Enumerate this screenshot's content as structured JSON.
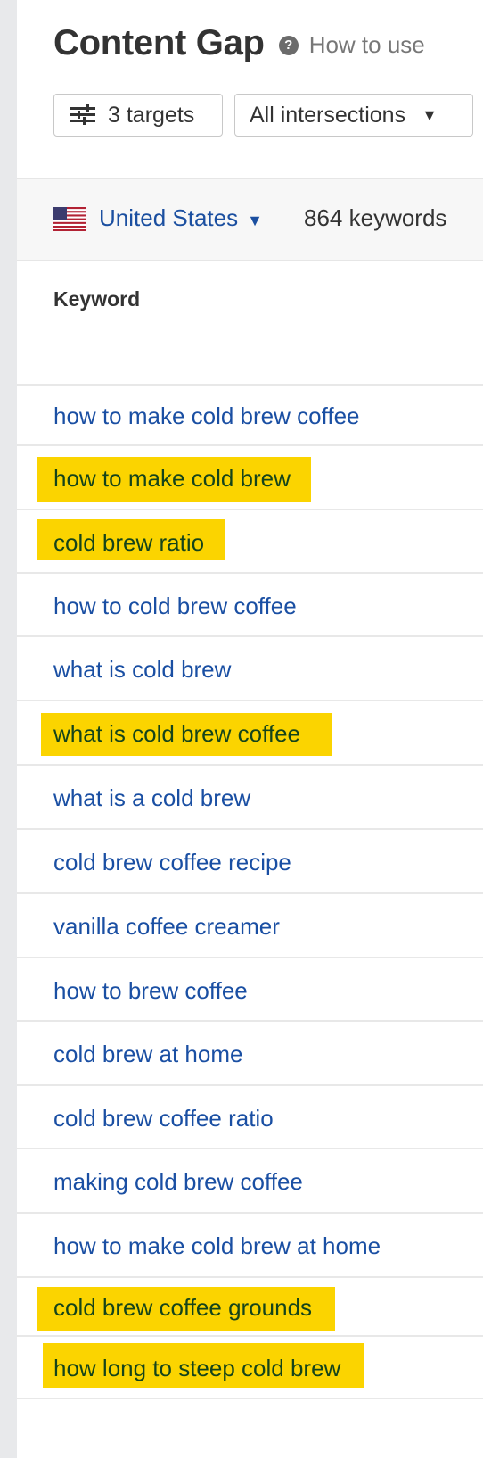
{
  "header": {
    "title": "Content Gap",
    "help_icon": "question-circle-icon",
    "help_label": "How to use"
  },
  "toolbar": {
    "targets_icon": "sliders-icon",
    "targets_label": "3 targets",
    "intersections_label": "All intersections",
    "intersections_caret": "▼"
  },
  "filter": {
    "flag_icon": "us-flag-icon",
    "country": "United States",
    "country_caret": "▼",
    "keyword_count": "864 keywords"
  },
  "table": {
    "column_header": "Keyword",
    "highlight_color": "#fbd400",
    "rows": [
      {
        "keyword": "how to make cold brew coffee",
        "highlighted": false
      },
      {
        "keyword": "how to make cold brew",
        "highlighted": true
      },
      {
        "keyword": "cold brew ratio",
        "highlighted": true
      },
      {
        "keyword": "how to cold brew coffee",
        "highlighted": false
      },
      {
        "keyword": "what is cold brew",
        "highlighted": false
      },
      {
        "keyword": "what is cold brew coffee",
        "highlighted": true
      },
      {
        "keyword": "what is a cold brew",
        "highlighted": false
      },
      {
        "keyword": "cold brew coffee recipe",
        "highlighted": false
      },
      {
        "keyword": "vanilla coffee creamer",
        "highlighted": false
      },
      {
        "keyword": "how to brew coffee",
        "highlighted": false
      },
      {
        "keyword": "cold brew at home",
        "highlighted": false
      },
      {
        "keyword": "cold brew coffee ratio",
        "highlighted": false
      },
      {
        "keyword": "making cold brew coffee",
        "highlighted": false
      },
      {
        "keyword": "how to make cold brew at home",
        "highlighted": false
      },
      {
        "keyword": "cold brew coffee grounds",
        "highlighted": true
      },
      {
        "keyword": "how long to steep cold brew",
        "highlighted": true
      }
    ]
  },
  "colors": {
    "link": "#1a4fa3",
    "text": "#333333",
    "highlight": "#fbd400"
  }
}
